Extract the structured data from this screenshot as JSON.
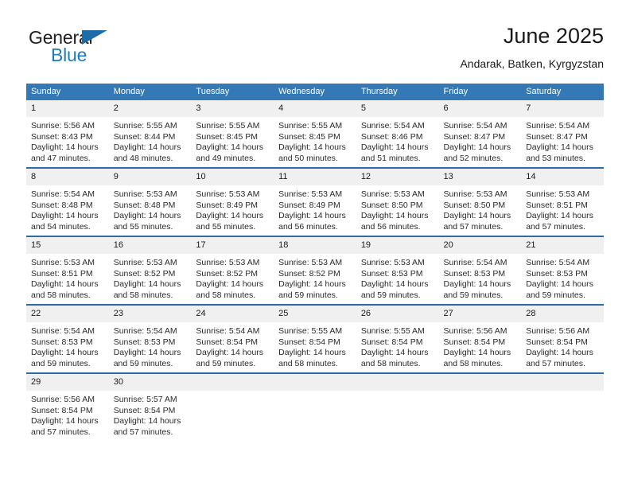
{
  "brand": {
    "name_top": "General",
    "name_bottom": "Blue",
    "colors": {
      "general_text": "#231f20",
      "blue_text": "#1f7ac0",
      "triangle": "#1b6ca8"
    }
  },
  "header": {
    "title": "June 2025",
    "subtitle": "Andarak, Batken, Kyrgyzstan"
  },
  "theme": {
    "header_bg": "#3479b6",
    "day_number_bg": "#f0f0f0",
    "week_separator": "#2d6ca6",
    "page_bg": "#ffffff"
  },
  "calendar": {
    "weekday_headers": [
      "Sunday",
      "Monday",
      "Tuesday",
      "Wednesday",
      "Thursday",
      "Friday",
      "Saturday"
    ],
    "weeks": [
      [
        {
          "day": "1",
          "sunrise": "Sunrise: 5:56 AM",
          "sunset": "Sunset: 8:43 PM",
          "daylight_line1": "Daylight: 14 hours",
          "daylight_line2": "and 47 minutes."
        },
        {
          "day": "2",
          "sunrise": "Sunrise: 5:55 AM",
          "sunset": "Sunset: 8:44 PM",
          "daylight_line1": "Daylight: 14 hours",
          "daylight_line2": "and 48 minutes."
        },
        {
          "day": "3",
          "sunrise": "Sunrise: 5:55 AM",
          "sunset": "Sunset: 8:45 PM",
          "daylight_line1": "Daylight: 14 hours",
          "daylight_line2": "and 49 minutes."
        },
        {
          "day": "4",
          "sunrise": "Sunrise: 5:55 AM",
          "sunset": "Sunset: 8:45 PM",
          "daylight_line1": "Daylight: 14 hours",
          "daylight_line2": "and 50 minutes."
        },
        {
          "day": "5",
          "sunrise": "Sunrise: 5:54 AM",
          "sunset": "Sunset: 8:46 PM",
          "daylight_line1": "Daylight: 14 hours",
          "daylight_line2": "and 51 minutes."
        },
        {
          "day": "6",
          "sunrise": "Sunrise: 5:54 AM",
          "sunset": "Sunset: 8:47 PM",
          "daylight_line1": "Daylight: 14 hours",
          "daylight_line2": "and 52 minutes."
        },
        {
          "day": "7",
          "sunrise": "Sunrise: 5:54 AM",
          "sunset": "Sunset: 8:47 PM",
          "daylight_line1": "Daylight: 14 hours",
          "daylight_line2": "and 53 minutes."
        }
      ],
      [
        {
          "day": "8",
          "sunrise": "Sunrise: 5:54 AM",
          "sunset": "Sunset: 8:48 PM",
          "daylight_line1": "Daylight: 14 hours",
          "daylight_line2": "and 54 minutes."
        },
        {
          "day": "9",
          "sunrise": "Sunrise: 5:53 AM",
          "sunset": "Sunset: 8:48 PM",
          "daylight_line1": "Daylight: 14 hours",
          "daylight_line2": "and 55 minutes."
        },
        {
          "day": "10",
          "sunrise": "Sunrise: 5:53 AM",
          "sunset": "Sunset: 8:49 PM",
          "daylight_line1": "Daylight: 14 hours",
          "daylight_line2": "and 55 minutes."
        },
        {
          "day": "11",
          "sunrise": "Sunrise: 5:53 AM",
          "sunset": "Sunset: 8:49 PM",
          "daylight_line1": "Daylight: 14 hours",
          "daylight_line2": "and 56 minutes."
        },
        {
          "day": "12",
          "sunrise": "Sunrise: 5:53 AM",
          "sunset": "Sunset: 8:50 PM",
          "daylight_line1": "Daylight: 14 hours",
          "daylight_line2": "and 56 minutes."
        },
        {
          "day": "13",
          "sunrise": "Sunrise: 5:53 AM",
          "sunset": "Sunset: 8:50 PM",
          "daylight_line1": "Daylight: 14 hours",
          "daylight_line2": "and 57 minutes."
        },
        {
          "day": "14",
          "sunrise": "Sunrise: 5:53 AM",
          "sunset": "Sunset: 8:51 PM",
          "daylight_line1": "Daylight: 14 hours",
          "daylight_line2": "and 57 minutes."
        }
      ],
      [
        {
          "day": "15",
          "sunrise": "Sunrise: 5:53 AM",
          "sunset": "Sunset: 8:51 PM",
          "daylight_line1": "Daylight: 14 hours",
          "daylight_line2": "and 58 minutes."
        },
        {
          "day": "16",
          "sunrise": "Sunrise: 5:53 AM",
          "sunset": "Sunset: 8:52 PM",
          "daylight_line1": "Daylight: 14 hours",
          "daylight_line2": "and 58 minutes."
        },
        {
          "day": "17",
          "sunrise": "Sunrise: 5:53 AM",
          "sunset": "Sunset: 8:52 PM",
          "daylight_line1": "Daylight: 14 hours",
          "daylight_line2": "and 58 minutes."
        },
        {
          "day": "18",
          "sunrise": "Sunrise: 5:53 AM",
          "sunset": "Sunset: 8:52 PM",
          "daylight_line1": "Daylight: 14 hours",
          "daylight_line2": "and 59 minutes."
        },
        {
          "day": "19",
          "sunrise": "Sunrise: 5:53 AM",
          "sunset": "Sunset: 8:53 PM",
          "daylight_line1": "Daylight: 14 hours",
          "daylight_line2": "and 59 minutes."
        },
        {
          "day": "20",
          "sunrise": "Sunrise: 5:54 AM",
          "sunset": "Sunset: 8:53 PM",
          "daylight_line1": "Daylight: 14 hours",
          "daylight_line2": "and 59 minutes."
        },
        {
          "day": "21",
          "sunrise": "Sunrise: 5:54 AM",
          "sunset": "Sunset: 8:53 PM",
          "daylight_line1": "Daylight: 14 hours",
          "daylight_line2": "and 59 minutes."
        }
      ],
      [
        {
          "day": "22",
          "sunrise": "Sunrise: 5:54 AM",
          "sunset": "Sunset: 8:53 PM",
          "daylight_line1": "Daylight: 14 hours",
          "daylight_line2": "and 59 minutes."
        },
        {
          "day": "23",
          "sunrise": "Sunrise: 5:54 AM",
          "sunset": "Sunset: 8:53 PM",
          "daylight_line1": "Daylight: 14 hours",
          "daylight_line2": "and 59 minutes."
        },
        {
          "day": "24",
          "sunrise": "Sunrise: 5:54 AM",
          "sunset": "Sunset: 8:54 PM",
          "daylight_line1": "Daylight: 14 hours",
          "daylight_line2": "and 59 minutes."
        },
        {
          "day": "25",
          "sunrise": "Sunrise: 5:55 AM",
          "sunset": "Sunset: 8:54 PM",
          "daylight_line1": "Daylight: 14 hours",
          "daylight_line2": "and 58 minutes."
        },
        {
          "day": "26",
          "sunrise": "Sunrise: 5:55 AM",
          "sunset": "Sunset: 8:54 PM",
          "daylight_line1": "Daylight: 14 hours",
          "daylight_line2": "and 58 minutes."
        },
        {
          "day": "27",
          "sunrise": "Sunrise: 5:56 AM",
          "sunset": "Sunset: 8:54 PM",
          "daylight_line1": "Daylight: 14 hours",
          "daylight_line2": "and 58 minutes."
        },
        {
          "day": "28",
          "sunrise": "Sunrise: 5:56 AM",
          "sunset": "Sunset: 8:54 PM",
          "daylight_line1": "Daylight: 14 hours",
          "daylight_line2": "and 57 minutes."
        }
      ],
      [
        {
          "day": "29",
          "sunrise": "Sunrise: 5:56 AM",
          "sunset": "Sunset: 8:54 PM",
          "daylight_line1": "Daylight: 14 hours",
          "daylight_line2": "and 57 minutes."
        },
        {
          "day": "30",
          "sunrise": "Sunrise: 5:57 AM",
          "sunset": "Sunset: 8:54 PM",
          "daylight_line1": "Daylight: 14 hours",
          "daylight_line2": "and 57 minutes."
        },
        {
          "day": "",
          "sunrise": "",
          "sunset": "",
          "daylight_line1": "",
          "daylight_line2": ""
        },
        {
          "day": "",
          "sunrise": "",
          "sunset": "",
          "daylight_line1": "",
          "daylight_line2": ""
        },
        {
          "day": "",
          "sunrise": "",
          "sunset": "",
          "daylight_line1": "",
          "daylight_line2": ""
        },
        {
          "day": "",
          "sunrise": "",
          "sunset": "",
          "daylight_line1": "",
          "daylight_line2": ""
        },
        {
          "day": "",
          "sunrise": "",
          "sunset": "",
          "daylight_line1": "",
          "daylight_line2": ""
        }
      ]
    ]
  }
}
